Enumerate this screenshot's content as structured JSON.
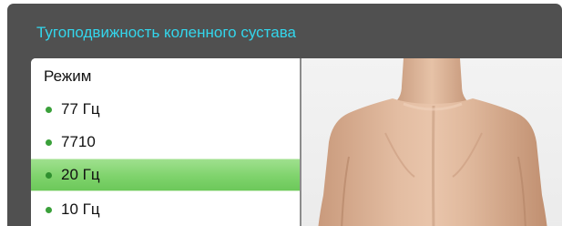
{
  "header": {
    "title": "Тугоподвижность коленного сустава"
  },
  "mode_list": {
    "header": "Режим",
    "selected_index": 2,
    "items": [
      {
        "label": "77 Гц"
      },
      {
        "label": "7710"
      },
      {
        "label": "20 Гц"
      },
      {
        "label": "10 Гц"
      }
    ]
  },
  "image": {
    "icon": "human-back-illustration"
  },
  "colors": {
    "title": "#33d6ec",
    "frame": "#505050",
    "selected": "#7fd36c",
    "bullet": "#3aa03a"
  }
}
